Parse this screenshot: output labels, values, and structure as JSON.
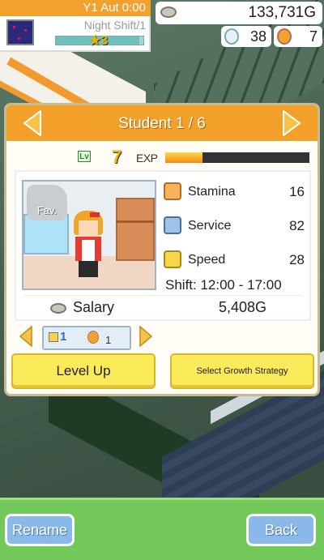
{
  "hud": {
    "date": "Y1 Aut 0:00",
    "shift_label": "Night Shift/1",
    "rank": "3",
    "shift_progress": 0.95,
    "money": "133,731G",
    "ideas": "38",
    "medals": "7"
  },
  "panel": {
    "title": "Student 1 / 6",
    "level_badge": "Lv",
    "level": "7",
    "exp_label": "EXP",
    "exp_progress": 0.26,
    "fav_label": "Fav.",
    "stats": [
      {
        "label": "Stamina",
        "value": "16"
      },
      {
        "label": "Service",
        "value": "82"
      },
      {
        "label": "Speed",
        "value": "28"
      }
    ],
    "shift": "Shift: 12:00 - 17:00",
    "salary_label": "Salary",
    "salary_value": "5,408G",
    "items": {
      "item_count": "1",
      "medal_count": "1"
    },
    "level_up_label": "Level Up",
    "growth_label": "Select Growth Strategy"
  },
  "bottom": {
    "rename_label": "Rename",
    "back_label": "Back"
  },
  "colors": {
    "header_orange": "#f2a02a",
    "button_yellow": "#fbea5a",
    "bottom_green": "#73c85a",
    "bottom_button_blue": "#8ab8e8"
  }
}
